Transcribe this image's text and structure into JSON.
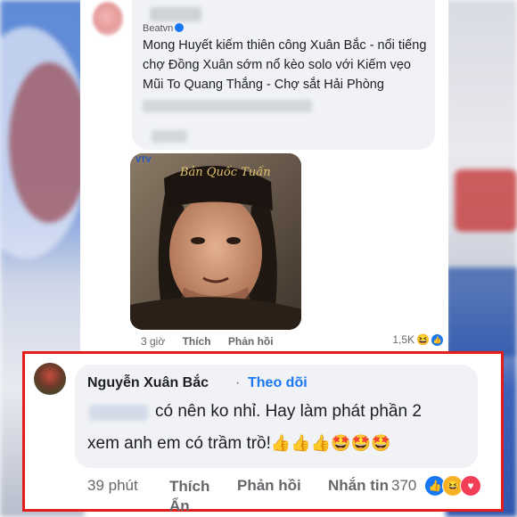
{
  "post": {
    "page_name": "Beatvn",
    "comment_text": "Mong Huyết kiếm thiên công Xuân Bắc - nổi tiếng chợ Đồng Xuân sớm nổ kèo solo với Kiếm vẹo Mũi To Quang Thắng - Chợ sắt Hải Phòng",
    "photo_caption": "Bản Quốc Tuấn",
    "tv_logo": "VTV",
    "actions": {
      "time": "3 giờ",
      "like": "Thích",
      "reply": "Phản hồi"
    },
    "reaction_count": "1,5K"
  },
  "reply_comment": {
    "author": "Nguyễn Xuân Bắc",
    "separator": "·",
    "follow_label": "Theo dõi",
    "text_line1": "có nên ko nhỉ. Hay làm phát phần 2",
    "text_line2": "xem anh em có trầm trồ!",
    "emojis": "👍👍👍🤩🤩🤩",
    "actions": {
      "time": "39 phút",
      "like": "Thích Ẩn",
      "reply": "Phản hồi",
      "message": "Nhắn tin"
    },
    "reaction_count": "370"
  },
  "colors": {
    "accent": "#1877f2",
    "highlight_border": "#e51c1c",
    "bubble": "#f0f2f5"
  }
}
